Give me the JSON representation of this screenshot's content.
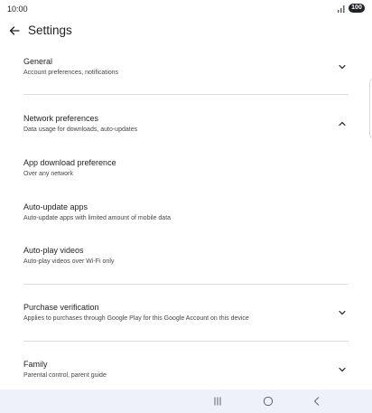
{
  "status": {
    "time": "10:00",
    "battery": "100"
  },
  "header": {
    "title": "Settings"
  },
  "sections": [
    {
      "title": "General",
      "subtitle": "Account preferences, notifications",
      "expanded": false
    },
    {
      "title": "Network preferences",
      "subtitle": "Data usage for downloads, auto-updates",
      "expanded": true,
      "items": [
        {
          "title": "App download preference",
          "subtitle": "Over any network"
        },
        {
          "title": "Auto-update apps",
          "subtitle": "Auto-update apps with limited amount of mobile data"
        },
        {
          "title": "Auto-play videos",
          "subtitle": "Auto-play videos over Wi-Fi only"
        }
      ]
    },
    {
      "title": "Purchase verification",
      "subtitle": "Applies to purchases through Google Play for this Google Account on this device",
      "expanded": false
    },
    {
      "title": "Family",
      "subtitle": "Parental control, parent guide",
      "expanded": false
    }
  ],
  "icons": {
    "back": "arrow-left-icon",
    "expand": "chevron-down-icon",
    "collapse": "chevron-up-icon",
    "recents": "recents-icon",
    "home": "home-icon",
    "nav_back": "back-icon"
  }
}
